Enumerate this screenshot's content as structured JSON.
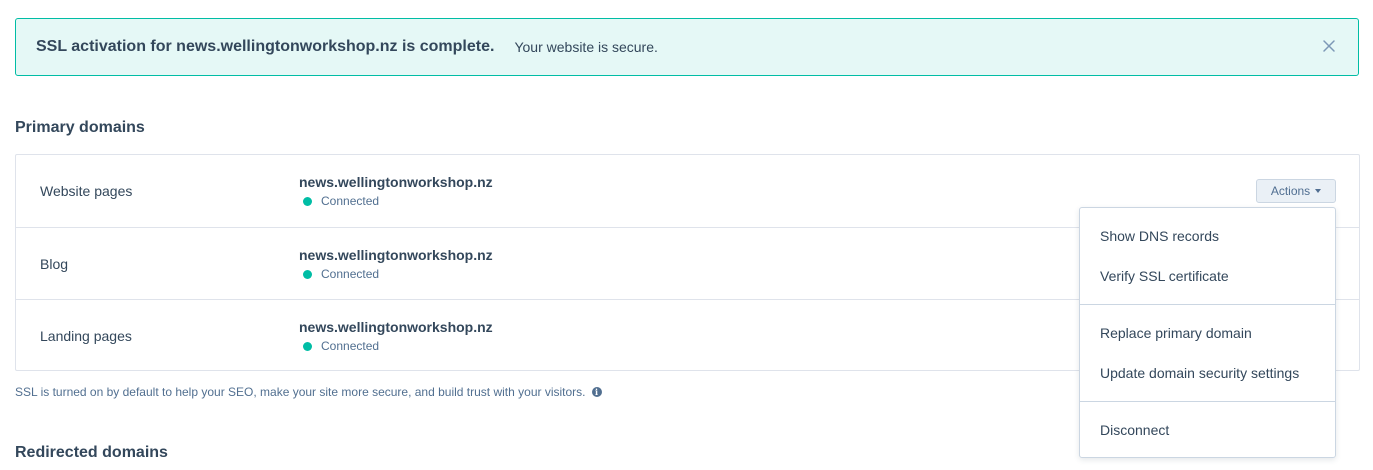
{
  "alert": {
    "title": "SSL activation for news.wellingtonworkshop.nz is complete.",
    "message": "Your website is secure."
  },
  "primary_domains": {
    "title": "Primary domains",
    "rows": [
      {
        "label": "Website pages",
        "domain": "news.wellingtonworkshop.nz",
        "status": "Connected"
      },
      {
        "label": "Blog",
        "domain": "news.wellingtonworkshop.nz",
        "status": "Connected"
      },
      {
        "label": "Landing pages",
        "domain": "news.wellingtonworkshop.nz",
        "status": "Connected"
      }
    ],
    "actions_label": "Actions",
    "footnote": "SSL is turned on by default to help your SEO, make your site more secure, and build trust with your visitors."
  },
  "actions_menu": {
    "items": [
      "Show DNS records",
      "Verify SSL certificate",
      "Replace primary domain",
      "Update domain security settings",
      "Disconnect"
    ]
  },
  "redirected_domains": {
    "title": "Redirected domains"
  },
  "colors": {
    "alert_bg": "#e5f8f6",
    "alert_border": "#00bda5",
    "status_connected": "#00bda5",
    "text_primary": "#33475b"
  },
  "icons": {
    "close": "close-icon",
    "info": "info-icon",
    "status": "status-dot-icon",
    "caret": "caret-down-icon"
  }
}
